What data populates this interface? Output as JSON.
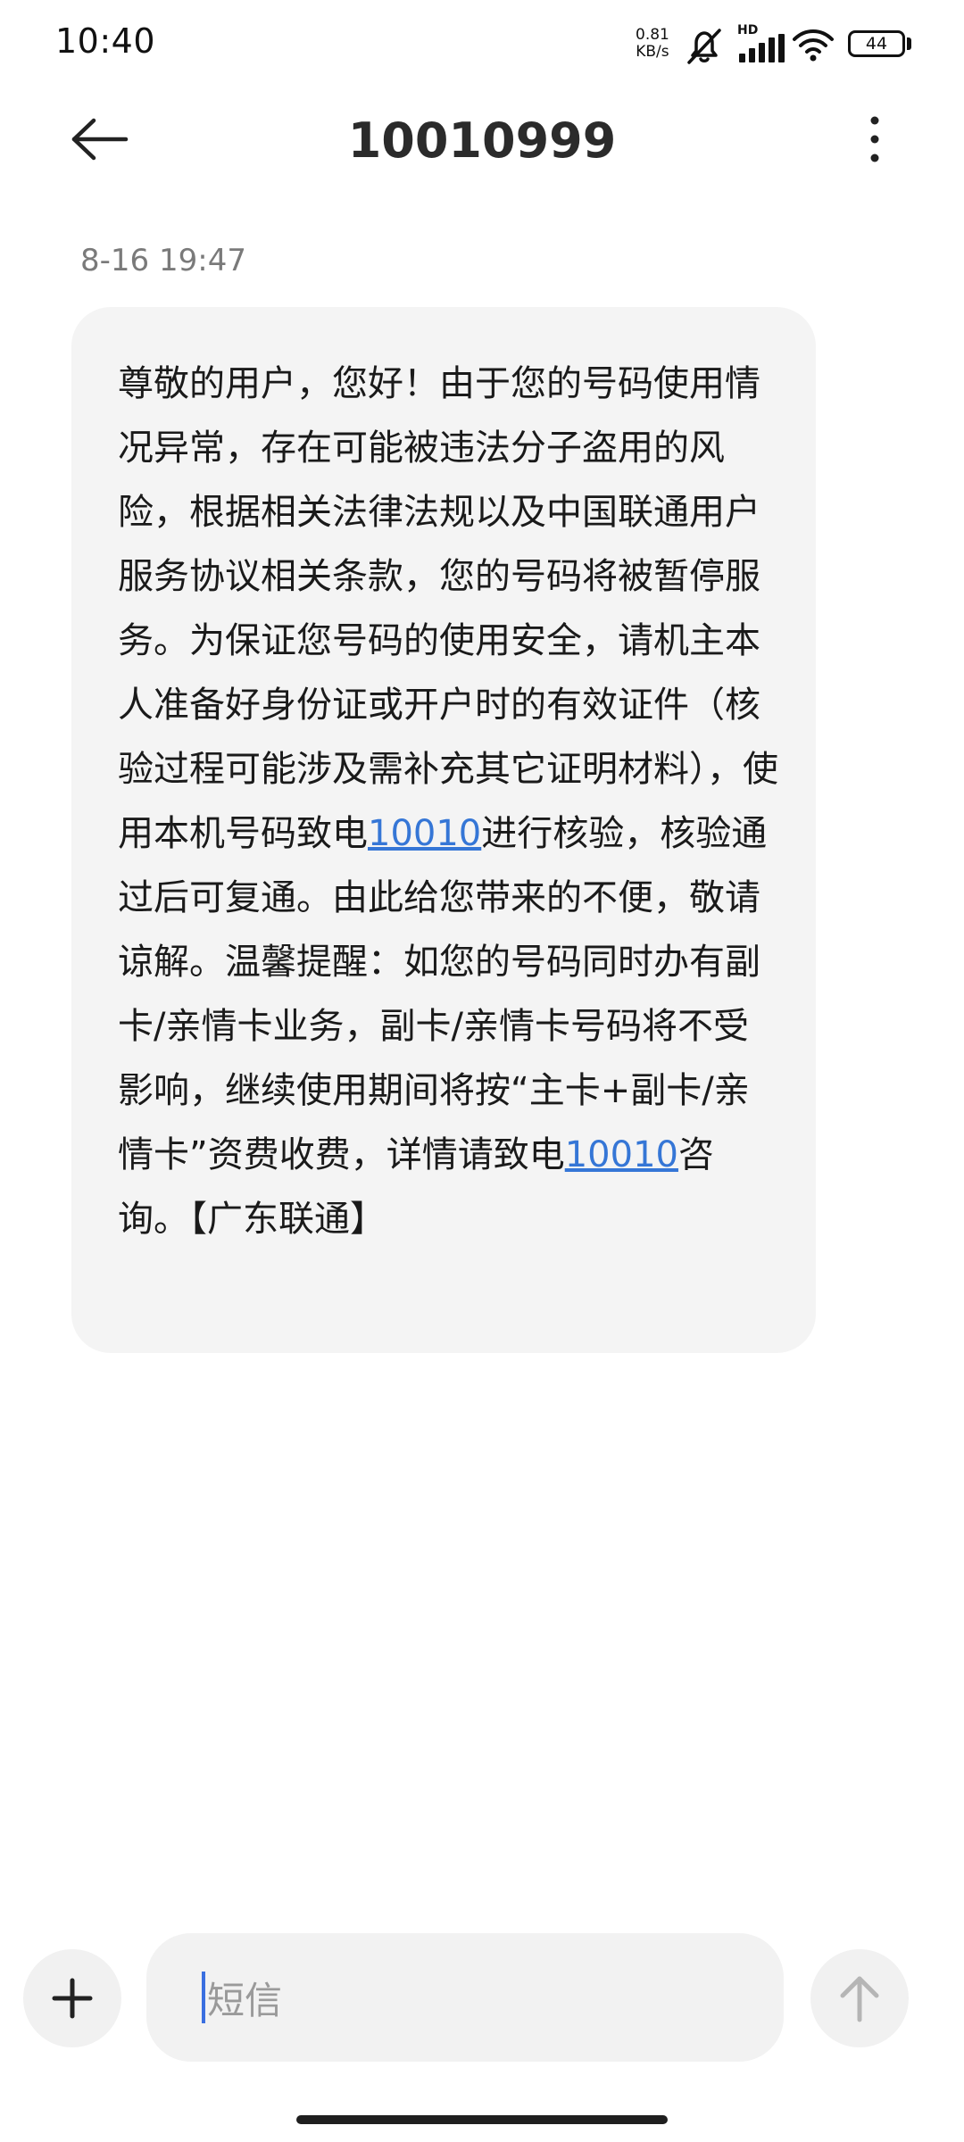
{
  "status_bar": {
    "time": "10:40",
    "net_speed_value": "0.81",
    "net_speed_unit": "KB/s",
    "signal_label": "HD",
    "battery": "44",
    "icons": [
      "mute-bell-icon",
      "signal-icon",
      "wifi-icon",
      "battery-icon"
    ]
  },
  "header": {
    "contact": "10010999",
    "back_icon": "arrow-left-icon",
    "more_icon": "more-vertical-icon"
  },
  "conversation": {
    "timestamp": "8-16 19:47",
    "message": {
      "part1": "尊敬的用户，您好！由于您的号码使用情况异常，存在可能被违法分子盗用的风险，根据相关法律法规以及中国联通用户服务协议相关条款，您的号码将被暂停服务。为保证您号码的使用安全，请机主本人准备好身份证或开户时的有效证件（核验过程可能涉及需补充其它证明材料），使用本机号码致电",
      "link1": "10010",
      "part2": "进行核验，核验通过后可复通。由此给您带来的不便，敬请谅解。温馨提醒：如您的号码同时办有副卡/亲情卡业务，副卡/亲情卡号码将不受影响，继续使用期间将按“主卡+副卡/亲情卡”资费收费，详情请致电",
      "link2": "10010",
      "part3": "咨询。【广东联通】"
    }
  },
  "composer": {
    "placeholder": "短信",
    "add_icon": "plus-icon",
    "send_icon": "arrow-up-icon"
  },
  "colors": {
    "link": "#3576d6",
    "bubble": "#f4f4f4",
    "cursor": "#3a6fe0"
  }
}
